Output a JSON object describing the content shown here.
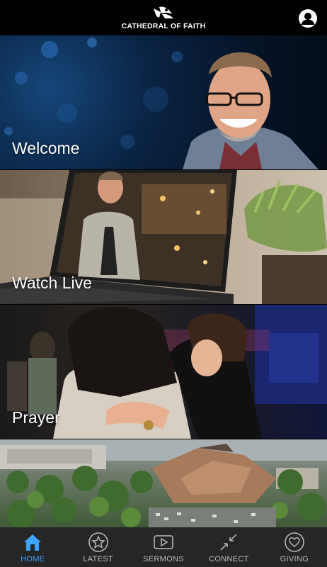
{
  "app": {
    "logo_text": "CATHEDRAL OF FAITH"
  },
  "panels": [
    {
      "label": "Welcome"
    },
    {
      "label": "Watch Live"
    },
    {
      "label": "Prayer"
    },
    {
      "label": ""
    }
  ],
  "tabs": [
    {
      "label": "HOME",
      "icon": "home-icon",
      "active": true
    },
    {
      "label": "LATEST",
      "icon": "star-icon",
      "active": false
    },
    {
      "label": "SERMONS",
      "icon": "play-icon",
      "active": false
    },
    {
      "label": "CONNECT",
      "icon": "connect-icon",
      "active": false
    },
    {
      "label": "GIVING",
      "icon": "heart-icon",
      "active": false
    }
  ],
  "colors": {
    "header_bg": "#000000",
    "tabbar_bg": "#262626",
    "active_tab": "#3ea3ff",
    "inactive_tab": "#bdbdbd"
  }
}
